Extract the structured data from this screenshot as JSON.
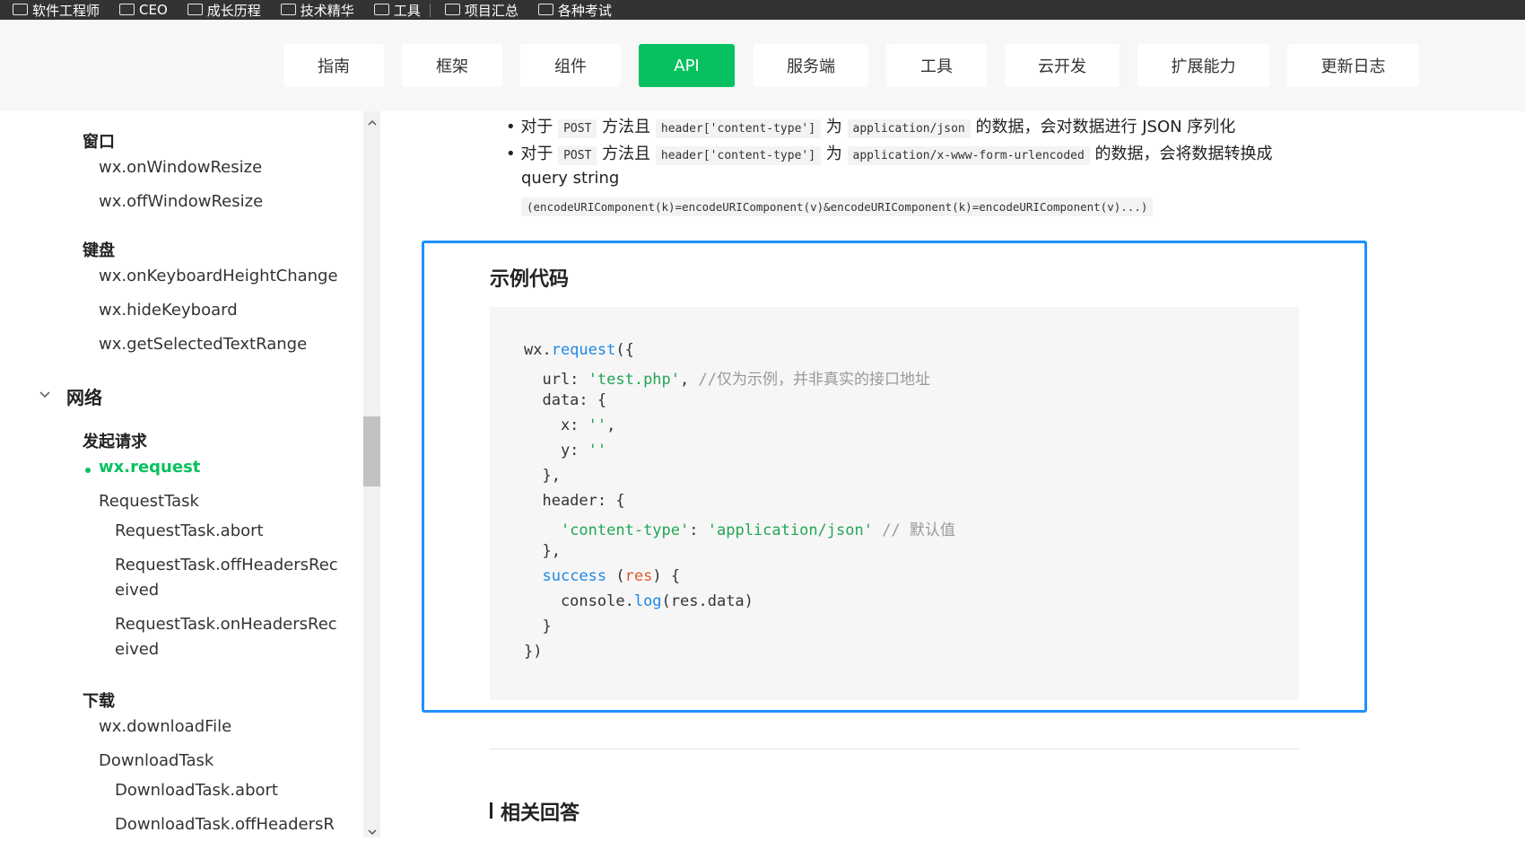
{
  "bookmarks": [
    "软件工程师",
    "CEO",
    "成长历程",
    "技术精华",
    "工具",
    "项目汇总",
    "各种考试"
  ],
  "nav": {
    "items": [
      "指南",
      "框架",
      "组件",
      "API",
      "服务端",
      "工具",
      "云开发",
      "扩展能力",
      "更新日志"
    ],
    "active": "API"
  },
  "sidebar": {
    "window_heading": "窗口",
    "window_items": [
      "wx.onWindowResize",
      "wx.offWindowResize"
    ],
    "keyboard_heading": "键盘",
    "keyboard_items": [
      "wx.onKeyboardHeightChange",
      "wx.hideKeyboard",
      "wx.getSelectedTextRange"
    ],
    "network_group": "网络",
    "request_heading": "发起请求",
    "request_active": "wx.request",
    "request_task": "RequestTask",
    "request_task_items": [
      "RequestTask.abort",
      "RequestTask.offHeadersRec",
      "eived",
      "RequestTask.onHeadersRec",
      "eived"
    ],
    "download_heading": "下载",
    "download_items": [
      "wx.downloadFile",
      "DownloadTask"
    ],
    "download_task_items": [
      "DownloadTask.abort",
      "DownloadTask.offHeadersR"
    ]
  },
  "content": {
    "bullet1": {
      "prefix": "对于",
      "code1": "POST",
      "mid": "方法且",
      "code2": "header['content-type']",
      "is": "为",
      "code3": "application/json",
      "suffix": "的数据，会对数据进行 JSON 序列化"
    },
    "bullet2": {
      "prefix": "对于",
      "code1": "POST",
      "mid": "方法且",
      "code2": "header['content-type']",
      "is": "为",
      "code3": "application/x-www-form-urlencoded",
      "suffix": "的数据，会将数据转换成"
    },
    "query_string": "query string",
    "query_code": "(encodeURIComponent(k)=encodeURIComponent(v)&encodeURIComponent(k)=encodeURIComponent(v)...)",
    "example_title": "示例代码",
    "code": {
      "l1_a": "wx.",
      "l1_b": "request",
      "l1_c": "({",
      "l2_a": "  url: ",
      "l2_b": "'test.php'",
      "l2_c": ", ",
      "l2_d": "//仅为示例，并非真实的接口地址",
      "l3": "  data: {",
      "l4_a": "    x: ",
      "l4_b": "''",
      "l4_c": ",",
      "l5_a": "    y: ",
      "l5_b": "''",
      "l6": "  },",
      "l7": "  header: {",
      "l8_a": "    ",
      "l8_b": "'content-type'",
      "l8_c": ": ",
      "l8_d": "'application/json'",
      "l8_e": " // 默认值",
      "l9": "  },",
      "l10_a": "  ",
      "l10_b": "success",
      "l10_c": " (",
      "l10_d": "res",
      "l10_e": ") {",
      "l11_a": "    console.",
      "l11_b": "log",
      "l11_c": "(res.data)",
      "l12": "  }",
      "l13": "})"
    },
    "related_title": "相关回答"
  }
}
